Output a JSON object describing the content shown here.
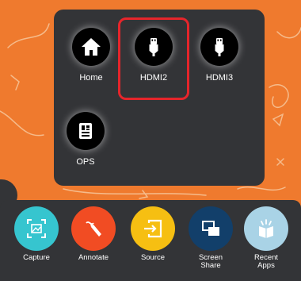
{
  "sources": [
    {
      "label": "Home",
      "icon": "home-icon"
    },
    {
      "label": "HDMI2",
      "icon": "hdmi-plug-icon",
      "selected": true
    },
    {
      "label": "HDMI3",
      "icon": "hdmi-plug-icon"
    },
    {
      "label": "OPS",
      "icon": "ops-module-icon"
    }
  ],
  "dock": [
    {
      "label": "Capture",
      "icon": "capture-icon",
      "color": "#36c5cf"
    },
    {
      "label": "Annotate",
      "icon": "annotate-pen-icon",
      "color": "#f14c23"
    },
    {
      "label": "Source",
      "icon": "source-input-icon",
      "color": "#f6bf12"
    },
    {
      "label": "Screen\nShare",
      "icon": "screen-share-icon",
      "color": "#123f6a"
    },
    {
      "label": "Recent\nApps",
      "icon": "recent-apps-icon",
      "color": "#a9d3e6"
    }
  ],
  "colors": {
    "background": "#ef7a2e",
    "panel": "#333437",
    "selection": "#e6252b"
  }
}
